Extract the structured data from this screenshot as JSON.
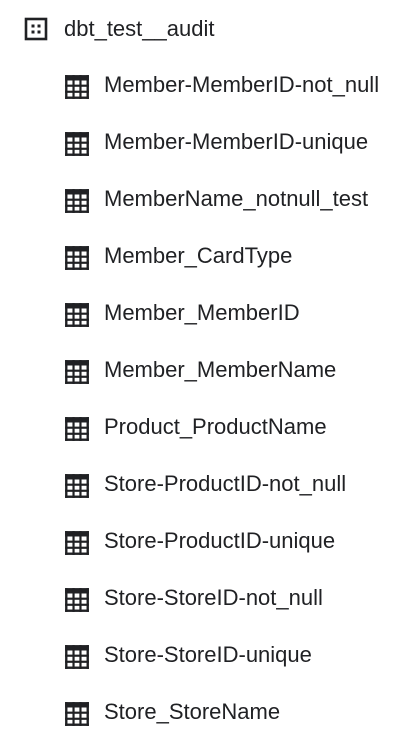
{
  "dataset": {
    "name": "dbt_test__audit",
    "icon": "dataset-icon"
  },
  "tables": [
    {
      "label": "Member-MemberID-not_null",
      "icon": "table-icon"
    },
    {
      "label": "Member-MemberID-unique",
      "icon": "table-icon"
    },
    {
      "label": "MemberName_notnull_test",
      "icon": "table-icon"
    },
    {
      "label": "Member_CardType",
      "icon": "table-icon"
    },
    {
      "label": "Member_MemberID",
      "icon": "table-icon"
    },
    {
      "label": "Member_MemberName",
      "icon": "table-icon"
    },
    {
      "label": "Product_ProductName",
      "icon": "table-icon"
    },
    {
      "label": "Store-ProductID-not_null",
      "icon": "table-icon"
    },
    {
      "label": "Store-ProductID-unique",
      "icon": "table-icon"
    },
    {
      "label": "Store-StoreID-not_null",
      "icon": "table-icon"
    },
    {
      "label": "Store-StoreID-unique",
      "icon": "table-icon"
    },
    {
      "label": "Store_StoreName",
      "icon": "table-icon"
    }
  ],
  "colors": {
    "text": "#202124",
    "icon": "#202124",
    "background": "#ffffff"
  }
}
